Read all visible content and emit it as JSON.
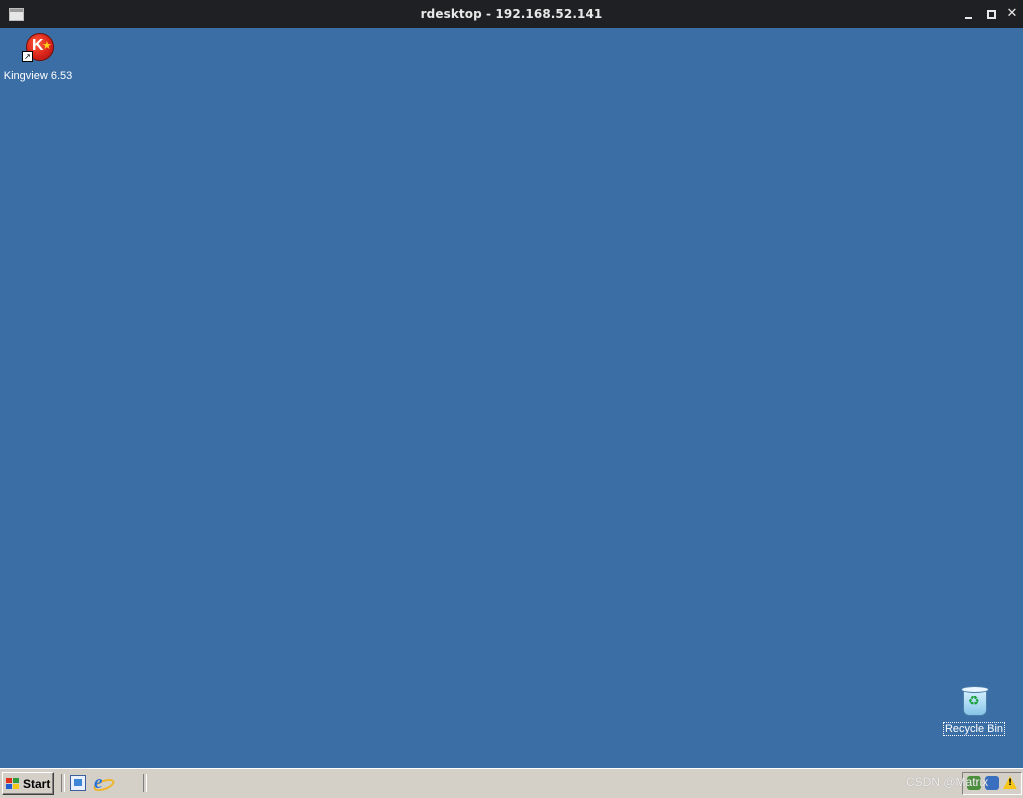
{
  "window": {
    "title": "rdesktop - 192.168.52.141",
    "icon": "window-icon",
    "controls": [
      "minimize-icon",
      "maximize-icon",
      "close-icon"
    ],
    "close_glyph": "✕"
  },
  "desktop": {
    "background": "#3a6ea5",
    "icons": [
      {
        "label": "Kingview 6.53",
        "icon": "kingview-icon",
        "shortcut": true
      },
      {
        "label": "Recycle Bin",
        "icon": "recycle-bin-icon",
        "selected": true
      }
    ]
  },
  "taskbar": {
    "start_label": "Start",
    "quick_launch": [
      "show-desktop-icon",
      "internet-explorer-icon"
    ],
    "tray_icons": [
      "network-icon",
      "volume-icon",
      "security-warning-icon"
    ]
  },
  "watermark": "CSDN @Matrix"
}
